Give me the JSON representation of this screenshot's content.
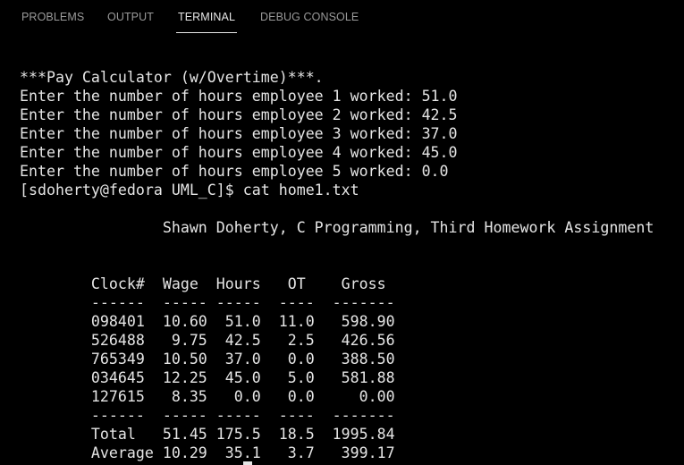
{
  "tabs": [
    {
      "label": "PROBLEMS"
    },
    {
      "label": "OUTPUT"
    },
    {
      "label": "TERMINAL"
    },
    {
      "label": "DEBUG CONSOLE"
    }
  ],
  "active_tab": "TERMINAL",
  "terminal": {
    "lines": [
      "***Pay Calculator (w/Overtime)***.",
      "Enter the number of hours employee 1 worked: 51.0",
      "Enter the number of hours employee 2 worked: 42.5",
      "Enter the number of hours employee 3 worked: 37.0",
      "Enter the number of hours employee 4 worked: 45.0",
      "Enter the number of hours employee 5 worked: 0.0",
      "[sdoherty@fedora UML_C]$ cat home1.txt",
      "",
      "                Shawn Doherty, C Programming, Third Homework Assignment",
      "",
      "",
      "        Clock#  Wage  Hours   OT    Gross",
      "        ------  ----- -----  ----  -------",
      "        098401  10.60  51.0  11.0   598.90",
      "        526488   9.75  42.5   2.5   426.56",
      "        765349  10.50  37.0   0.0   388.50",
      "        034645  12.25  45.0   5.0   581.88",
      "        127615   8.35   0.0   0.0     0.00",
      "        ------  ----- -----  ----  -------",
      "        Total   51.45 175.5  18.5  1995.84",
      "        Average 10.29  35.1   3.7   399.17"
    ]
  },
  "colors": {
    "background": "#000000",
    "text": "#e5e5e5",
    "tab_inactive": "#9a9a9a",
    "tab_active": "#e7e7e7"
  }
}
